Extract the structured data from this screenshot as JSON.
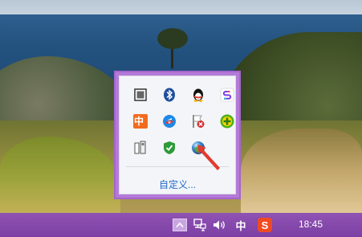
{
  "tray_popup": {
    "customize_link": "自定义...",
    "icons": [
      {
        "name": "tray-window-icon"
      },
      {
        "name": "bluetooth-icon"
      },
      {
        "name": "qq-penguin-icon"
      },
      {
        "name": "sync-app-icon"
      },
      {
        "name": "ime-zhong-icon",
        "text": "中"
      },
      {
        "name": "video-player-icon"
      },
      {
        "name": "security-flag-icon"
      },
      {
        "name": "green-plus-icon"
      },
      {
        "name": "usb-device-icon"
      },
      {
        "name": "shield-check-icon"
      },
      {
        "name": "globe-icon"
      }
    ]
  },
  "taskbar": {
    "ime_label": "中",
    "sogou_label": "S",
    "clock": "18:45"
  },
  "colors": {
    "taskbar": "#7c3fa4",
    "popup_border": "#b57ad9",
    "link": "#1f67c9",
    "arrow": "#e23b2e"
  }
}
